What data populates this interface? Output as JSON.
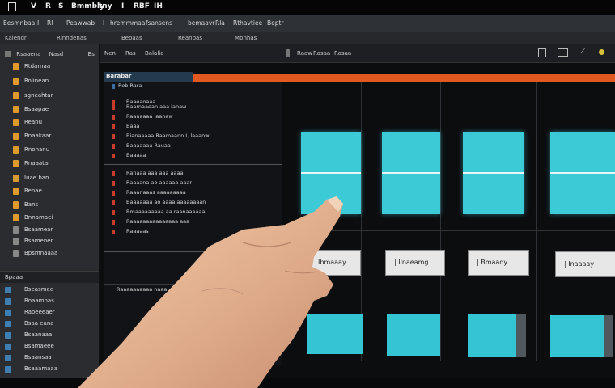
{
  "topbar": {
    "items": [
      "V",
      "R",
      "S",
      "Bmmbly",
      "tny",
      "I",
      "RBF",
      "IH"
    ]
  },
  "menubar": {
    "items": [
      "Eesmnbaa",
      "I",
      "Rl",
      "Peawwab",
      "I",
      "hremmmaa",
      "fsansens",
      "bemaavr",
      "Rla",
      "Rthavtiee",
      "Beptr"
    ]
  },
  "toolbar": {
    "items": [
      "Kalendr",
      "Rinndenas",
      "Beoaas",
      "Reanbas",
      "Mbnhas"
    ]
  },
  "sidebar": {
    "header": [
      "Rsaaena",
      "Nasd",
      "Bs"
    ],
    "items": [
      {
        "label": "Rtdarnaa"
      },
      {
        "label": "Rolinean"
      },
      {
        "label": "sgneahtar"
      },
      {
        "label": "Bsaapae"
      },
      {
        "label": "Reanu"
      },
      {
        "label": "Bnaakaar"
      },
      {
        "label": "Rnonanu"
      },
      {
        "label": "Rnaaatar"
      },
      {
        "label": "Iuae ban"
      },
      {
        "label": "Renae"
      },
      {
        "label": "Bans"
      },
      {
        "label": "Bnnamaei"
      },
      {
        "label": "Bsaamear"
      },
      {
        "label": "Bsamener"
      },
      {
        "label": "Bpsmnaaaa"
      }
    ],
    "section_label": "Bpaaa",
    "section_items": [
      {
        "label": "Bseasmee"
      },
      {
        "label": "Boaamnas"
      },
      {
        "label": "Raoeeeaer"
      },
      {
        "label": "Bsaa eana"
      },
      {
        "label": "Bsaanaaa"
      },
      {
        "label": "Bsamaeee"
      },
      {
        "label": "Bsaansaa"
      },
      {
        "label": "Bsaaamaaa"
      }
    ]
  },
  "mainhead": {
    "left": [
      "Nen",
      "Ras",
      "Balalia"
    ],
    "center": [
      "Raaw",
      "Rasaa",
      "Rasaa"
    ]
  },
  "panel": {
    "tab_label": "Barabar",
    "subtitle": "Reb Rara",
    "rows_a": [
      "Baaeaoaaa",
      "Raarnaaean aaa ianaw",
      "Raanaaaa laanaw",
      "Baaa",
      "Bianaaaaa Raamaann I, laaanw,",
      "Baaaaaaa Rauaa",
      "Baaaaa"
    ],
    "rows_b": [
      "Ranaaa aaa aaa aaaa",
      "Raaaana ao aaaaaa aaar",
      "Raaanaaas aaaaaaaaa",
      "Baaaaaaa ao aaaa aaaaaaaan",
      "Rmaaaaaaaaa aa raanaaaaaa",
      "Raaaaaaaaaaaaaaa aaa",
      "Raaaaas"
    ],
    "footer": "Raaaaaaaaaa naaa"
  },
  "cards": [
    {
      "label": "Ibmaaay"
    },
    {
      "label": "| Ilnaeamg"
    },
    {
      "label": "| Bmaady"
    },
    {
      "label": "| Inaaaay"
    }
  ],
  "colors": {
    "accent_orange": "#e2591f",
    "tile_cyan": "#3ccbd6",
    "sidebar_icon": "#e09a2b",
    "background": "#0c0d0f"
  }
}
